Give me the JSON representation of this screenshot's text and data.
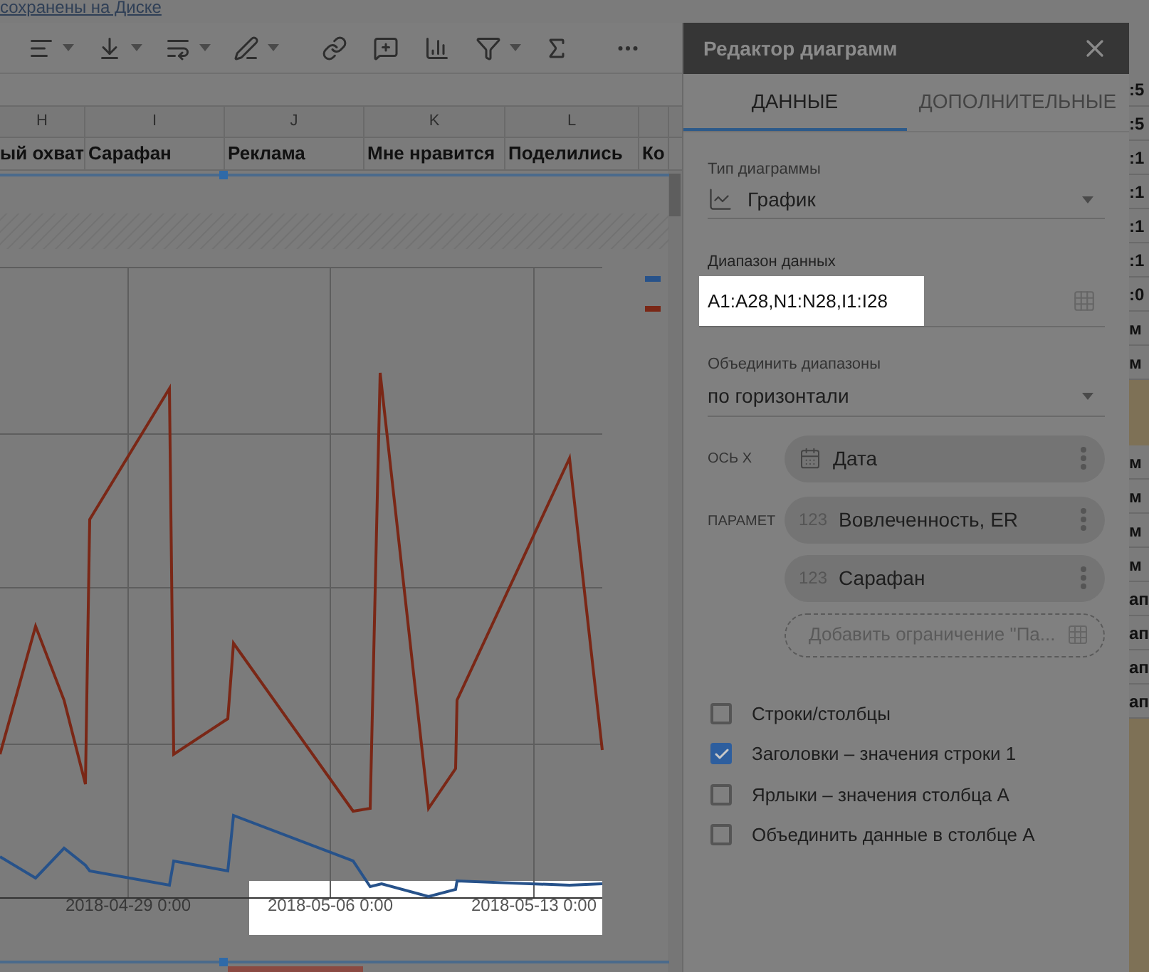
{
  "top_link": "сохранены на Диске",
  "columns": [
    {
      "letter": "H",
      "header": "ый охват"
    },
    {
      "letter": "I",
      "header": "Сарафан"
    },
    {
      "letter": "J",
      "header": "Реклама"
    },
    {
      "letter": "K",
      "header": "Мне нравится"
    },
    {
      "letter": "L",
      "header": "Поделились"
    },
    {
      "header": "Ко"
    }
  ],
  "chart": {
    "x_labels": [
      {
        "text": "2018-04-29 0:00",
        "highlighted": false
      },
      {
        "text": "2018-05-06 0:00",
        "highlighted": true
      },
      {
        "text": "2018-05-13 0:00",
        "highlighted": true
      }
    ]
  },
  "chart_editor": {
    "title": "Редактор диаграмм",
    "tabs": [
      {
        "label": "ДАННЫЕ",
        "selected": true
      },
      {
        "label": "ДОПОЛНИТЕЛЬНЫЕ",
        "selected": false
      }
    ],
    "chart_type": {
      "label": "Тип диаграммы",
      "value": "График"
    },
    "data_range": {
      "label": "Диапазон данных",
      "value": "A1:A28,N1:N28,I1:I28",
      "highlighted": true
    },
    "combine_ranges": {
      "label": "Объединить диапазоны",
      "value": "по горизонтали"
    },
    "x_axis": {
      "label": "ОСЬ X",
      "items": [
        {
          "name": "Дата"
        }
      ]
    },
    "series": {
      "label": "ПАРАМЕТ",
      "items": [
        {
          "badge": "123",
          "name": "Вовлеченность, ER"
        },
        {
          "badge": "123",
          "name": "Сарафан"
        }
      ],
      "add_placeholder": "Добавить ограничение \"Па..."
    },
    "options": [
      {
        "label": "Строки/столбцы",
        "checked": false
      },
      {
        "label": "Заголовки – значения строки 1",
        "checked": true
      },
      {
        "label": "Ярлыки – значения столбца A",
        "checked": false
      },
      {
        "label": "Объединить данные в столбце A",
        "checked": false
      }
    ]
  },
  "sheet_edge": [
    {
      "text": ":5",
      "kind": "cell"
    },
    {
      "text": ":5",
      "kind": "cell"
    },
    {
      "text": ":1",
      "kind": "cell"
    },
    {
      "text": ":1",
      "kind": "cell"
    },
    {
      "text": ":1",
      "kind": "cell"
    },
    {
      "text": ":1",
      "kind": "cell"
    },
    {
      "text": ":0",
      "kind": "cell"
    },
    {
      "text": "м",
      "kind": "cell"
    },
    {
      "text": "м",
      "kind": "cell"
    },
    {
      "kind": "band"
    },
    {
      "text": "м",
      "kind": "cell"
    },
    {
      "text": "м",
      "kind": "cell"
    },
    {
      "text": "м",
      "kind": "cell"
    },
    {
      "text": "м",
      "kind": "cell"
    },
    {
      "text": "ап",
      "kind": "cell"
    },
    {
      "text": "ап",
      "kind": "cell"
    },
    {
      "text": "ап",
      "kind": "cell"
    },
    {
      "text": "ап",
      "kind": "cell"
    },
    {
      "kind": "fill"
    }
  ]
}
